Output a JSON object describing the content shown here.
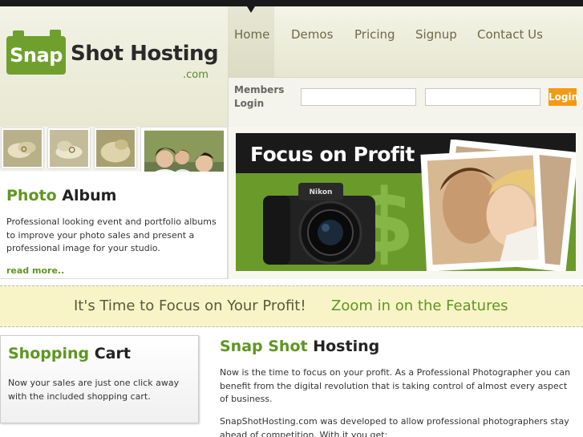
{
  "logo": {
    "badge": "Snap",
    "text": "Shot Hosting",
    "suffix": ".com"
  },
  "nav": {
    "items": [
      {
        "label": "Home",
        "active": true
      },
      {
        "label": "Demos"
      },
      {
        "label": "Pricing"
      },
      {
        "label": "Signup"
      },
      {
        "label": "Contact Us"
      }
    ]
  },
  "login": {
    "label": "Members Login",
    "button": "Login"
  },
  "album": {
    "title_green": "Photo",
    "title_dark": "Album",
    "description": "Professional looking event and portfolio albums to improve your photo sales and present a professional image for your studio.",
    "read_more": "read more.."
  },
  "banner": {
    "title": "Focus on Profit",
    "camera_brand": "Nikon"
  },
  "strip": {
    "left": "It's Time to Focus on Your Profit!",
    "right": "Zoom in on the Features"
  },
  "cart": {
    "title_green": "Shopping",
    "title_dark": "Cart",
    "description": "Now your sales are just one click away with the included shopping cart."
  },
  "main": {
    "title_green": "Snap Shot",
    "title_dark": "Hosting",
    "paragraph1": "Now is the time to focus on your profit. As a Professional Photographer you can benefit from the digital revolution that is taking control of almost every aspect of business.",
    "paragraph2": "SnapShotHosting.com was developed to allow professional photographers stay ahead of competition. With it you get:"
  },
  "colors": {
    "brand_green": "#5e9620",
    "login_orange": "#f39a14",
    "strip_yellow": "#f8f4c8"
  }
}
